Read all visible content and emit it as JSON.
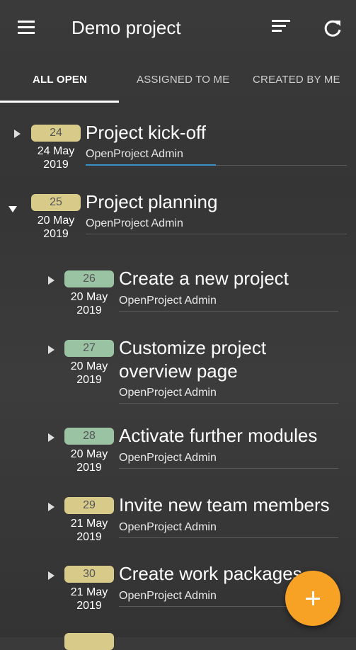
{
  "appbar": {
    "title": "Demo project"
  },
  "tabs": [
    {
      "label": "ALL OPEN"
    },
    {
      "label": "ASSIGNED TO ME"
    },
    {
      "label": "CREATED BY ME"
    }
  ],
  "items": [
    {
      "id": "24",
      "date_line1": "24 May",
      "date_line2": "2019",
      "subject": "Project kick-off",
      "author": "OpenProject Admin",
      "badge_color": "#d8cb8a"
    },
    {
      "id": "25",
      "date_line1": "20 May",
      "date_line2": "2019",
      "subject": "Project planning",
      "author": "OpenProject Admin",
      "badge_color": "#d8cb8a"
    },
    {
      "id": "26",
      "date_line1": "20 May",
      "date_line2": "2019",
      "subject": "Create a new project",
      "author": "OpenProject Admin",
      "badge_color": "#9ac3a4"
    },
    {
      "id": "27",
      "date_line1": "20 May",
      "date_line2": "2019",
      "subject_line1": "Customize project",
      "subject_line2": "overview page",
      "author": "OpenProject Admin",
      "badge_color": "#9ac3a4"
    },
    {
      "id": "28",
      "date_line1": "20 May",
      "date_line2": "2019",
      "subject": "Activate further modules",
      "author": "OpenProject Admin",
      "badge_color": "#9ac3a4"
    },
    {
      "id": "29",
      "date_line1": "21 May",
      "date_line2": "2019",
      "subject": "Invite new team members",
      "author": "OpenProject Admin",
      "badge_color": "#d8cb8a"
    },
    {
      "id": "30",
      "date_line1": "21 May",
      "date_line2": "2019",
      "subject": "Create work packages",
      "author": "OpenProject Admin",
      "badge_color": "#d8cb8a"
    }
  ],
  "colors": {
    "accent": "#f7a125",
    "focus_line": "#3a8fc4"
  },
  "icons": {
    "menu": "hamburger-icon",
    "sort": "sort-icon",
    "refresh": "refresh-icon",
    "add": "plus-icon"
  }
}
